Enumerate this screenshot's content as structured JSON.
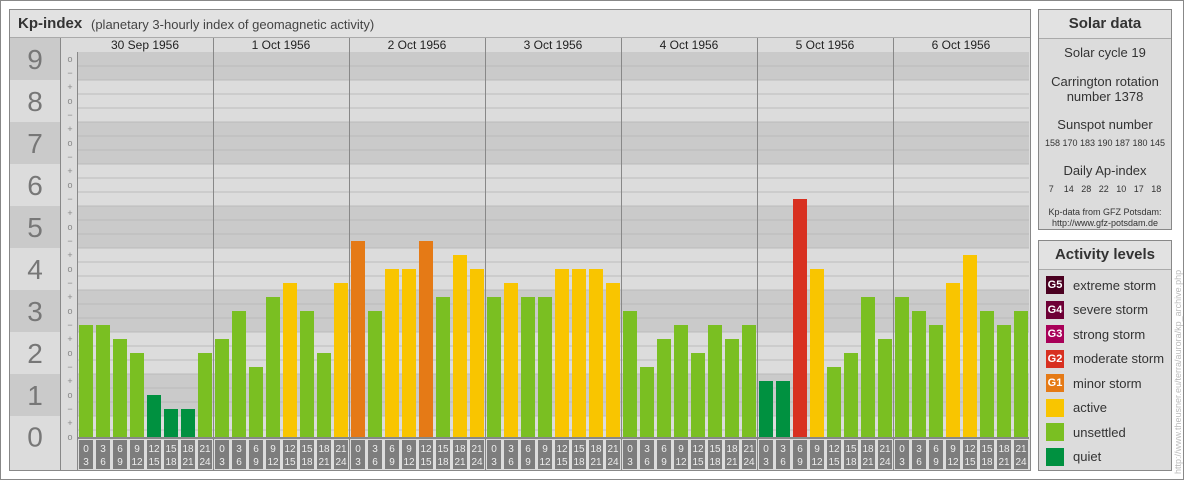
{
  "header": {
    "title": "Kp-index",
    "subtitle": "(planetary 3-hourly index of geomagnetic activity)"
  },
  "chart_data": {
    "type": "bar",
    "title": "Kp-index",
    "ylabel": "Kp",
    "ylim": [
      0,
      9
    ],
    "y_ticks": [
      "0",
      "1",
      "2",
      "3",
      "4",
      "5",
      "6",
      "7",
      "8",
      "9"
    ],
    "thirds_labels": [
      "o",
      "+",
      "−"
    ],
    "days": [
      "30 Sep 1956",
      "1 Oct 1956",
      "2 Oct 1956",
      "3 Oct 1956",
      "4 Oct 1956",
      "5 Oct 1956",
      "6 Oct 1956"
    ],
    "hour_slots": [
      [
        "0",
        "3"
      ],
      [
        "3",
        "6"
      ],
      [
        "6",
        "9"
      ],
      [
        "9",
        "12"
      ],
      [
        "12",
        "15"
      ],
      [
        "15",
        "18"
      ],
      [
        "18",
        "21"
      ],
      [
        "21",
        "24"
      ]
    ],
    "kp_values": [
      [
        "3-",
        "3-",
        "2+",
        "2o",
        "1o",
        "1-",
        "1-",
        "2o"
      ],
      [
        "2+",
        "3o",
        "2-",
        "3+",
        "4-",
        "3o",
        "2o",
        "4-"
      ],
      [
        "5-",
        "3o",
        "4o",
        "4o",
        "5-",
        "3+",
        "4+",
        "4o"
      ],
      [
        "3+",
        "4-",
        "3+",
        "3+",
        "4o",
        "4o",
        "4o",
        "4-"
      ],
      [
        "3o",
        "2-",
        "2+",
        "3-",
        "2o",
        "3-",
        "2+",
        "3-"
      ],
      [
        "1+",
        "1+",
        "6-",
        "4o",
        "2-",
        "2o",
        "3+",
        "2+"
      ],
      [
        "3+",
        "3o",
        "3-",
        "4-",
        "4+",
        "3o",
        "3-",
        "3o"
      ]
    ]
  },
  "solar": {
    "title": "Solar data",
    "cycle": "Solar cycle 19",
    "carrington_1": "Carrington rotation",
    "carrington_2": "number 1378",
    "sunspot_label": "Sunspot number",
    "sunspots": "158 170 183 190 187 180 145",
    "ap_label": "Daily Ap-index",
    "ap": "7    14   28   22   10   17   18",
    "source_1": "Kp-data from GFZ Potsdam:",
    "source_2": "http://www.gfz-potsdam.de"
  },
  "legend": {
    "title": "Activity levels",
    "items": [
      {
        "badge": "G5",
        "label": "extreme storm",
        "color": "#4a0020"
      },
      {
        "badge": "G4",
        "label": "severe storm",
        "color": "#6e0036"
      },
      {
        "badge": "G3",
        "label": "strong storm",
        "color": "#a80058"
      },
      {
        "badge": "G2",
        "label": "moderate storm",
        "color": "#d83020"
      },
      {
        "badge": "G1",
        "label": "minor storm",
        "color": "#e57a16"
      },
      {
        "badge": "",
        "label": "active",
        "color": "#f9c500"
      },
      {
        "badge": "",
        "label": "unsettled",
        "color": "#7abf22"
      },
      {
        "badge": "",
        "label": "quiet",
        "color": "#009140"
      }
    ]
  },
  "watermark": "http://www.theusner.eu/terra/aurora/kp_archive.php"
}
